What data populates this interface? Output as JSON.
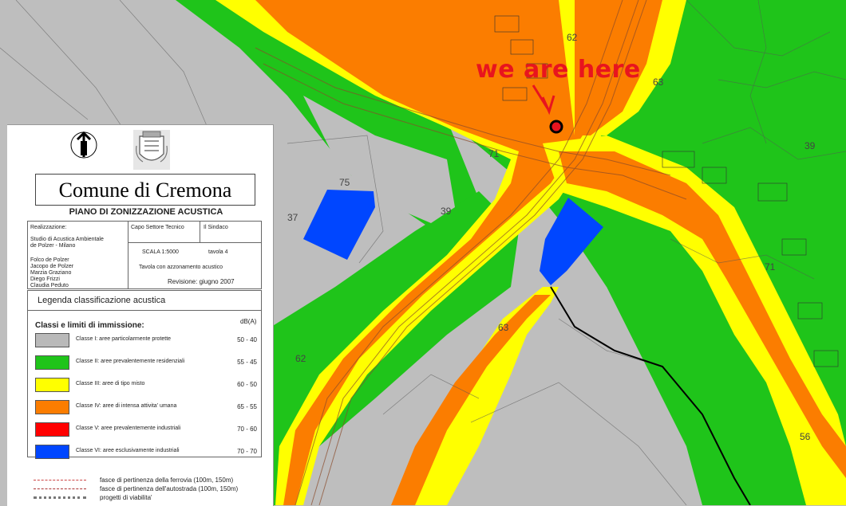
{
  "annotation": {
    "text": "we are here",
    "color": "#e8141e"
  },
  "map_labels": [
    "62",
    "63",
    "39",
    "75",
    "37",
    "71",
    "39",
    "71",
    "63",
    "62",
    "56"
  ],
  "panel": {
    "comune": "Comune di Cremona",
    "plan_title": "PIANO DI ZONIZZAZIONE ACUSTICA",
    "realizzazione_label": "Realizzazione:",
    "studio": [
      "Studio di Acustica Ambientale",
      "de Polzer - Milano"
    ],
    "team": [
      "Folco de Polzer",
      "Jacopo de Polzer",
      "Marzia Graziano",
      "Diego Frizzi",
      "Claudia Peduto"
    ],
    "capo": "Capo Settore Tecnico",
    "sindaco": "Il Sindaco",
    "scala": "SCALA 1:5000",
    "tavola": "tavola 4",
    "tavola_desc": "Tavola con azzonamento acustico",
    "revisione": "Revisione: giugno 2007",
    "north_label": "NORD"
  },
  "legend": {
    "title": "Legenda classificazione acustica",
    "classes_title": "Classi e limiti di immissione:",
    "db_header": "dB(A)",
    "classes": [
      {
        "label": "Classe I: aree particolarmente protette",
        "db": "50 - 40",
        "color": "#b9b9b9"
      },
      {
        "label": "Classe II: aree prevalentemente residenziali",
        "db": "55 - 45",
        "color": "#1fc41a"
      },
      {
        "label": "Classe III: aree di tipo misto",
        "db": "60 - 50",
        "color": "#ffff00"
      },
      {
        "label": "Classe IV: aree di intensa attivita' umana",
        "db": "65 - 55",
        "color": "#fb7d00"
      },
      {
        "label": "Classe V: aree prevalentemente industriali",
        "db": "70 - 60",
        "color": "#ff0000"
      },
      {
        "label": "Classe VI: aree esclusivamente industriali",
        "db": "70 - 70",
        "color": "#0046ff"
      }
    ],
    "footer": [
      {
        "label": "fasce di pertinenza della ferrovia (100m, 150m)",
        "style": "rail"
      },
      {
        "label": "fasce di pertinenza dell'autostrada (100m, 150m)",
        "style": "road"
      },
      {
        "label": "progetti di viabilita'",
        "style": "proj"
      }
    ]
  }
}
